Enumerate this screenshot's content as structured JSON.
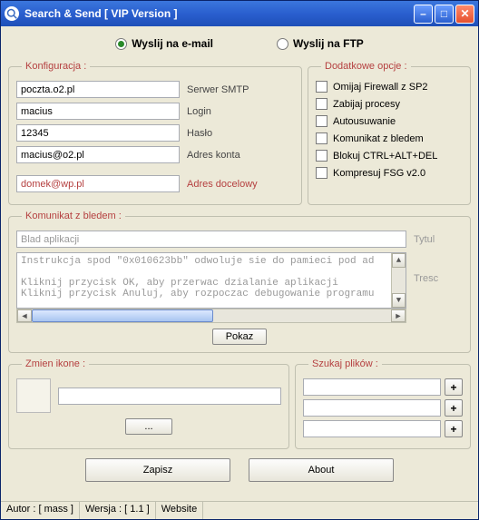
{
  "window": {
    "title": "Search & Send [ VIP Version ]"
  },
  "radio": {
    "email": "Wyslij na e-mail",
    "ftp": "Wyslij na FTP"
  },
  "konfig": {
    "legend": "Konfiguracja :",
    "smtp": {
      "value": "poczta.o2.pl",
      "label": "Serwer SMTP"
    },
    "login": {
      "value": "macius",
      "label": "Login"
    },
    "pass": {
      "value": "12345",
      "label": "Hasło"
    },
    "account": {
      "value": "macius@o2.pl",
      "label": "Adres konta"
    },
    "dest": {
      "value": "domek@wp.pl",
      "label": "Adres docelowy"
    }
  },
  "options": {
    "legend": "Dodatkowe opcje :",
    "items": [
      "Omijaj Firewall z SP2",
      "Zabijaj procesy",
      "Autousuwanie",
      "Komunikat z bledem",
      "Blokuj CTRL+ALT+DEL",
      "Kompresuj FSG v2.0"
    ]
  },
  "message": {
    "legend": "Komunikat z bledem :",
    "title_value": "Blad aplikacji",
    "title_label": "Tytul",
    "body": "Instrukcja spod \"0x010623bb\" odwoluje sie do pamieci pod ad\n\nKliknij przycisk OK, aby przerwac dzialanie aplikacji\nKliknij przycisk Anuluj, aby rozpoczac debugowanie programu",
    "body_label": "Tresc",
    "show_btn": "Pokaz"
  },
  "icon": {
    "legend": "Zmien ikone :",
    "path": "",
    "browse": "..."
  },
  "search": {
    "legend": "Szukaj plików :",
    "f1": "",
    "f2": "",
    "f3": ""
  },
  "buttons": {
    "save": "Zapisz",
    "about": "About"
  },
  "status": {
    "author": "Autor : [ mass ]",
    "version": "Wersja : [ 1.1 ]",
    "website": "Website"
  }
}
